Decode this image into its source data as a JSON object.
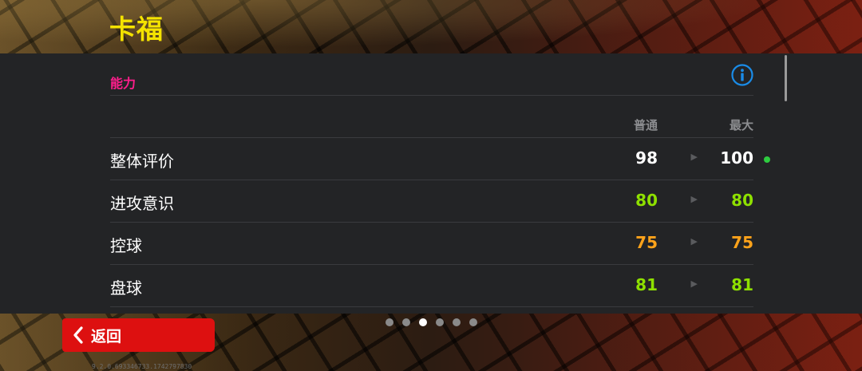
{
  "player": {
    "name": "卡福"
  },
  "section": {
    "title": "能力",
    "info_icon": "info-circle-icon"
  },
  "columns": {
    "normal": "普通",
    "max": "最大"
  },
  "colors": {
    "white": "#ffffff",
    "green": "#8ee000",
    "orange": "#ffa31a",
    "accent": "#ff1e8c",
    "info_blue": "#1a8ce8",
    "back_red": "#dd1010",
    "name_yellow": "#f4e300"
  },
  "rows": [
    {
      "label": "整体评价",
      "normal": "98",
      "max": "100",
      "normal_color": "#ffffff",
      "max_color": "#ffffff",
      "dot": true
    },
    {
      "label": "进攻意识",
      "normal": "80",
      "max": "80",
      "normal_color": "#8ee000",
      "max_color": "#8ee000",
      "dot": false
    },
    {
      "label": "控球",
      "normal": "75",
      "max": "75",
      "normal_color": "#ffa31a",
      "max_color": "#ffa31a",
      "dot": false
    },
    {
      "label": "盘球",
      "normal": "81",
      "max": "81",
      "normal_color": "#8ee000",
      "max_color": "#8ee000",
      "dot": false
    }
  ],
  "arrow_glyph": "▶",
  "pager": {
    "count": 6,
    "active_index": 2
  },
  "back_button": {
    "label": "返回",
    "icon": "chevron-left-icon"
  },
  "version": "9.2.0.693346733.1742797830"
}
